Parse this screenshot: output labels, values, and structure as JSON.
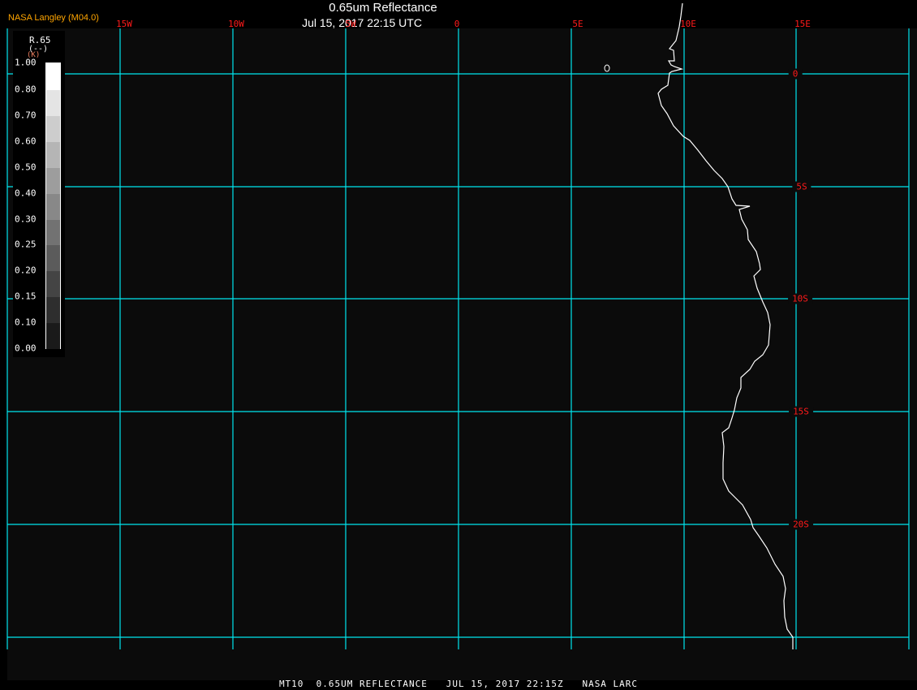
{
  "header": {
    "brand": "NASA Langley (M04.0)",
    "title": "0.65um Reflectance",
    "datetime": "Jul 15, 2017 22:15 UTC"
  },
  "map": {
    "grid_color": "#00e5ee",
    "label_color": "#ff1a1a",
    "coastline_color": "#ffffff",
    "longitude_labels": [
      "15W",
      "10W",
      "5W",
      "0",
      "5E",
      "10E",
      "15E"
    ],
    "latitude_labels": [
      "0",
      "5S",
      "10S",
      "15S",
      "20S"
    ]
  },
  "legend": {
    "name": "R.65",
    "unit": "(--)",
    "unit_marker": "(K)",
    "ticks": [
      "1.00",
      "0.80",
      "0.70",
      "0.60",
      "0.50",
      "0.40",
      "0.30",
      "0.25",
      "0.20",
      "0.15",
      "0.10",
      "0.00"
    ],
    "colors": [
      "#ffffff",
      "#e4e4e4",
      "#cdcdcd",
      "#b5b5b5",
      "#9d9d9d",
      "#888888",
      "#727272",
      "#5b5b5b",
      "#444444",
      "#2e2e2e",
      "#1a1a1a"
    ]
  },
  "footer": {
    "caption": "MT10  0.65UM REFLECTANCE   JUL 15, 2017 22:15Z   NASA LARC"
  }
}
